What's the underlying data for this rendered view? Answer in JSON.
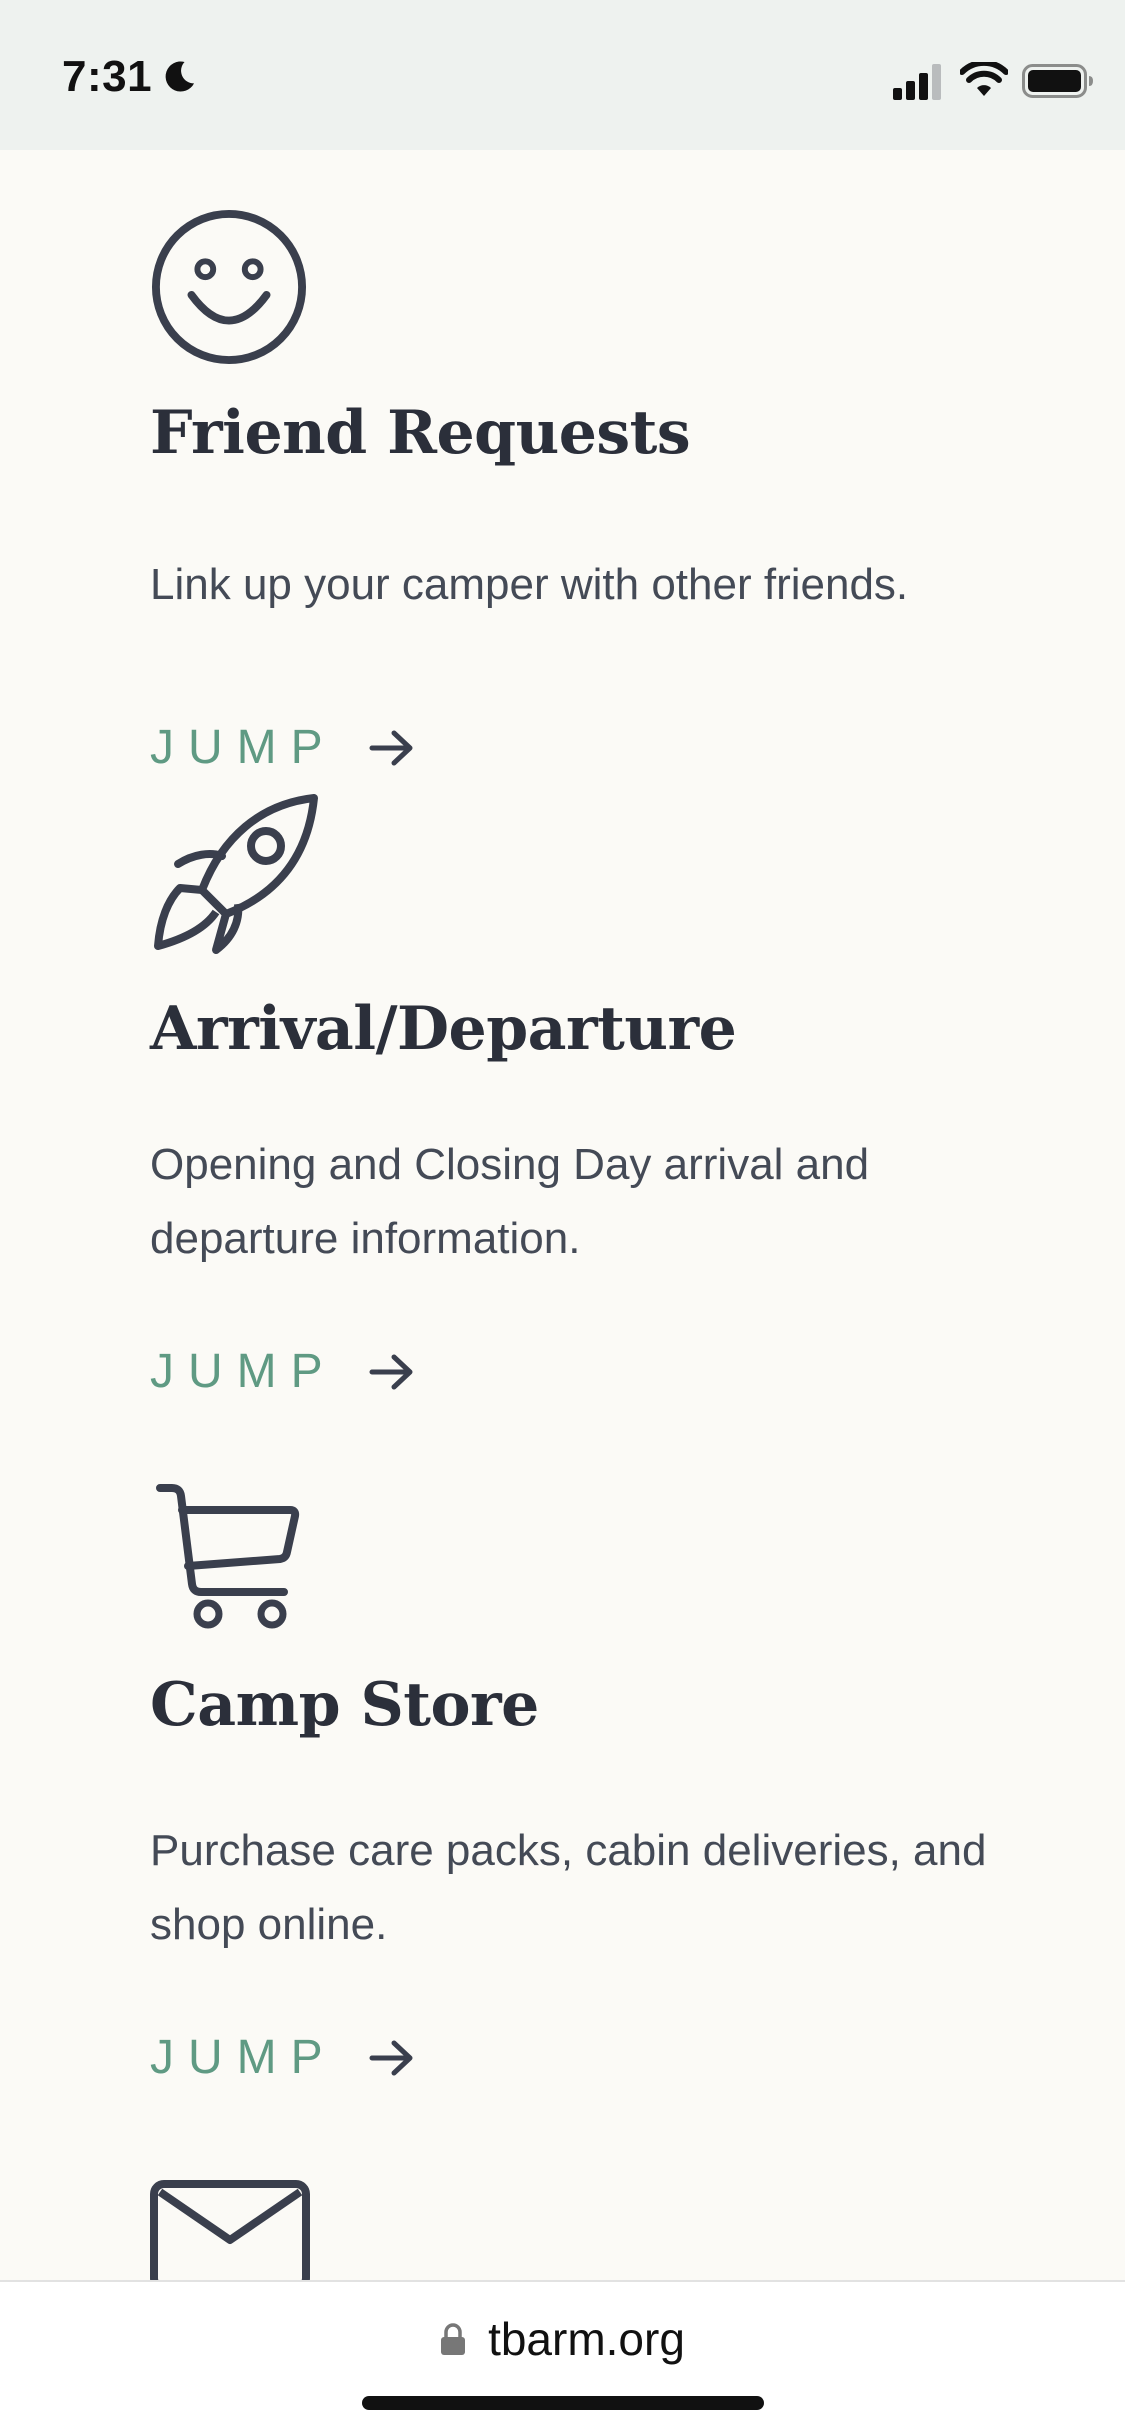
{
  "status_bar": {
    "time": "7:31",
    "icons": [
      "moon-icon",
      "signal-icon",
      "wifi-icon",
      "battery-icon"
    ]
  },
  "sections": [
    {
      "icon": "smiley-icon",
      "title": "Friend Requests",
      "description": "Link up your camper with other friends.",
      "link_label": "JUMP"
    },
    {
      "icon": "rocket-icon",
      "title": "Arrival/Departure",
      "description": "Opening and Closing Day arrival and departure information.",
      "link_label": "JUMP"
    },
    {
      "icon": "cart-icon",
      "title": "Camp Store",
      "description": "Purchase care packs, cabin deliveries, and shop online.",
      "link_label": "JUMP"
    },
    {
      "icon": "envelope-icon"
    }
  ],
  "browser": {
    "url": "tbarm.org",
    "lock_icon": "lock-icon"
  },
  "colors": {
    "background": "#fbfaf6",
    "status_bar_bg": "#eef2ef",
    "heading": "#2b2f3a",
    "body_text": "#444a56",
    "accent_green": "#5f9a83",
    "icon_stroke": "#3a3f4d"
  }
}
